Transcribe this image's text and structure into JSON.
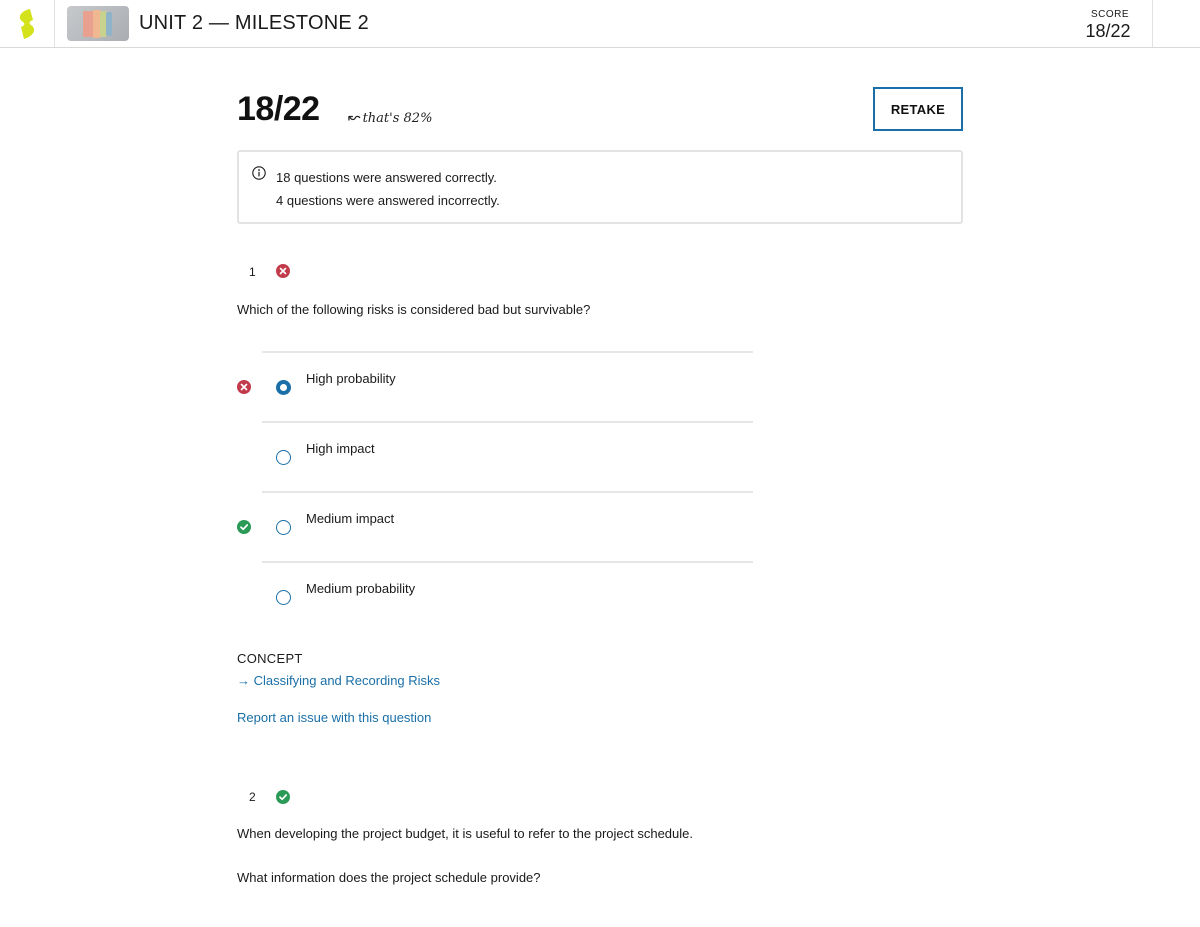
{
  "header": {
    "title": "UNIT 2 — MILESTONE 2",
    "score_label": "SCORE",
    "score_value": "18/22"
  },
  "results": {
    "score": "18/22",
    "percent_note": "that's 82%",
    "retake_label": "RETAKE",
    "summary": {
      "correct_count": "18",
      "correct_text": " questions were answered correctly.",
      "incorrect_count": "4",
      "incorrect_text": " questions were answered incorrectly."
    }
  },
  "questions": [
    {
      "number": "1",
      "status": "incorrect",
      "prompt": "Which of the following risks is considered bad but survivable?",
      "options": [
        {
          "label": "High probability",
          "selected": true,
          "marker": "incorrect"
        },
        {
          "label": "High impact",
          "selected": false,
          "marker": "none"
        },
        {
          "label": "Medium impact",
          "selected": false,
          "marker": "correct"
        },
        {
          "label": "Medium probability",
          "selected": false,
          "marker": "none"
        }
      ],
      "concept_label": "CONCEPT",
      "concept_link": "Classifying and Recording Risks",
      "report_link": "Report an issue with this question"
    },
    {
      "number": "2",
      "status": "correct",
      "prompt": "When developing the project budget, it is useful to refer to the project schedule.",
      "prompt2": "What information does the project schedule provide?"
    }
  ],
  "colors": {
    "accent": "#1a6fa8",
    "incorrect": "#c23b4b",
    "correct": "#2a9a56",
    "brand": "#d4e21b"
  }
}
